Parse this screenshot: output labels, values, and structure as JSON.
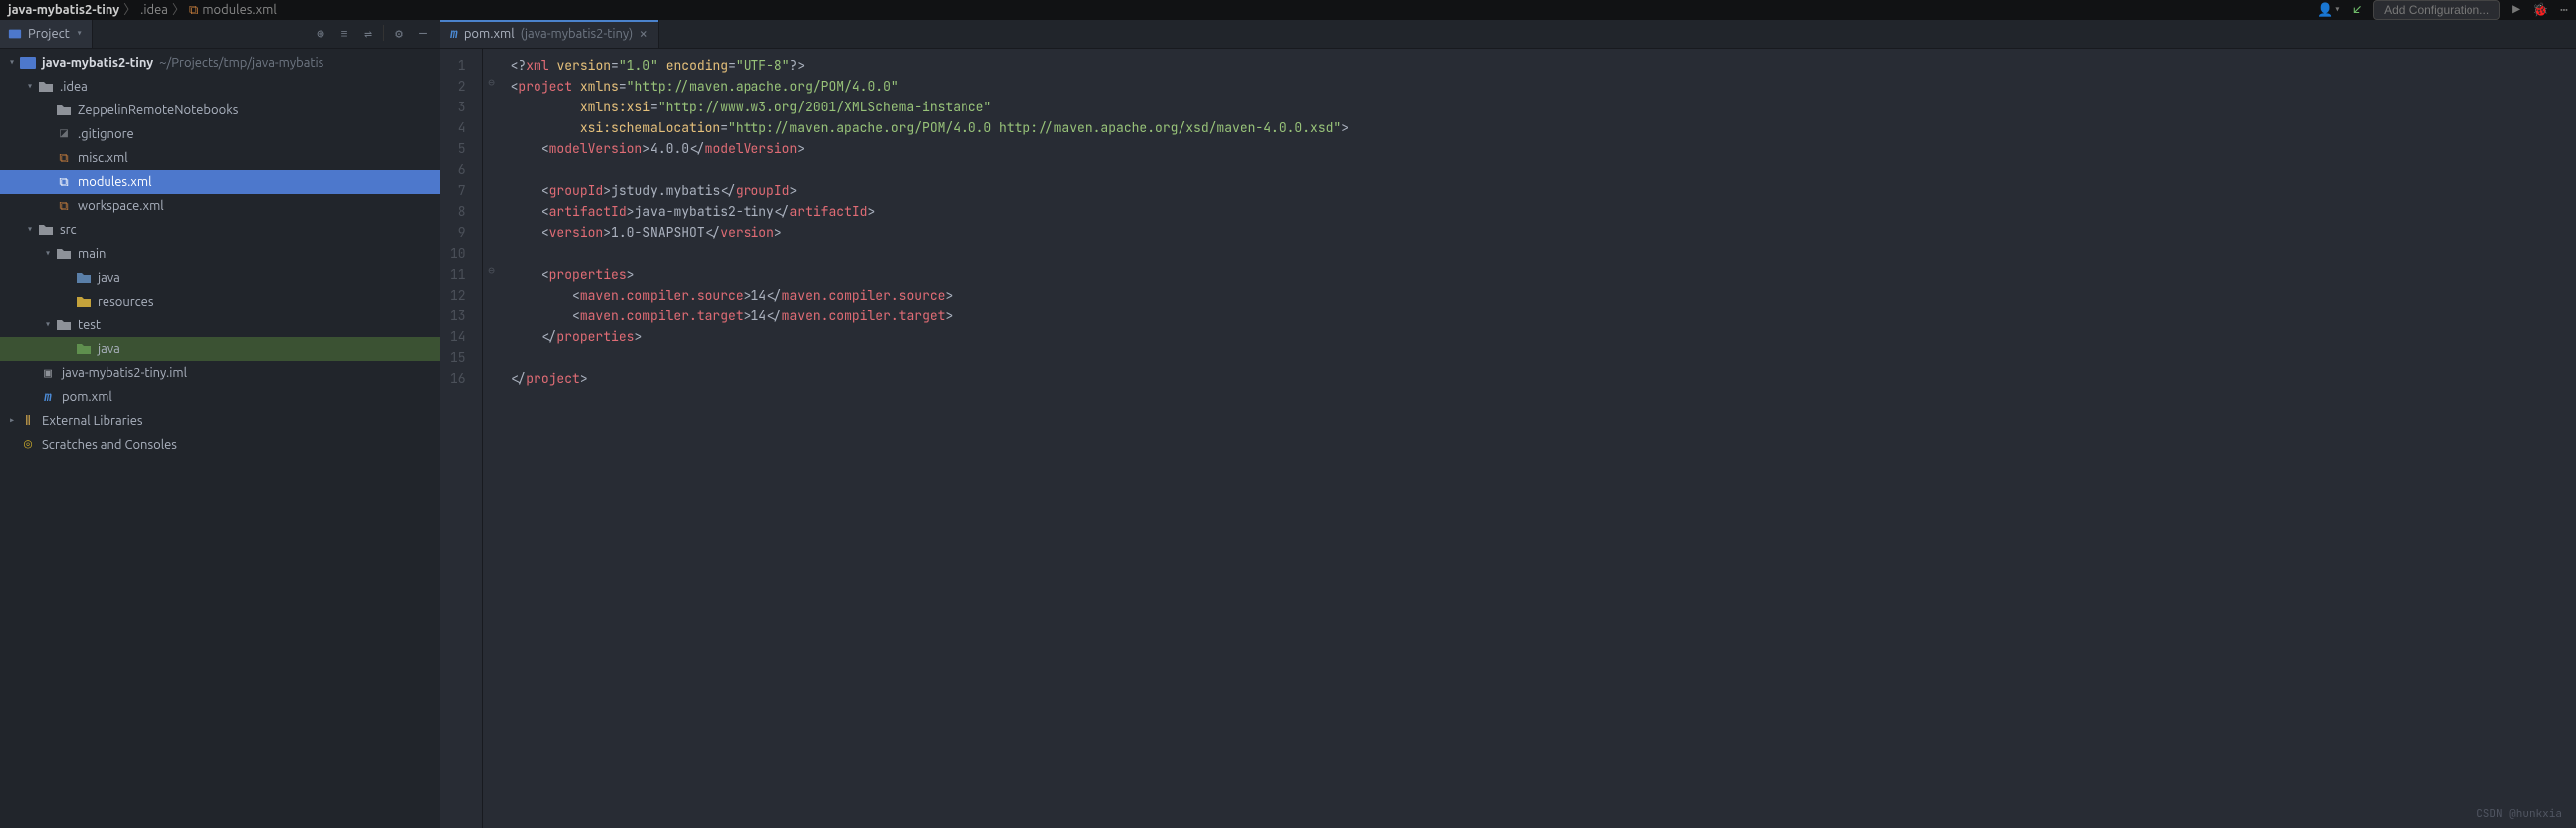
{
  "breadcrumb": {
    "root": "java-mybatis2-tiny",
    "p1": ".idea",
    "p2": "modules.xml"
  },
  "run_config": "Add Configuration...",
  "project_label": "Project",
  "tree": {
    "root": {
      "name": "java-mybatis2-tiny",
      "path": "~/Projects/tmp/java-mybatis"
    },
    "idea": ".idea",
    "zeppelin": "ZeppelinRemoteNotebooks",
    "gitignore": ".gitignore",
    "misc": "misc.xml",
    "modules": "modules.xml",
    "workspace": "workspace.xml",
    "src": "src",
    "main": "main",
    "main_java": "java",
    "main_res": "resources",
    "test": "test",
    "test_java": "java",
    "iml": "java-mybatis2-tiny.iml",
    "pom": "pom.xml",
    "ext": "External Libraries",
    "scratch": "Scratches and Consoles"
  },
  "tab": {
    "file": "pom.xml",
    "qual": "(java-mybatis2-tiny)"
  },
  "gutter": [
    "1",
    "2",
    "3",
    "4",
    "5",
    "6",
    "7",
    "8",
    "9",
    "10",
    "11",
    "12",
    "13",
    "14",
    "15",
    "16"
  ],
  "fold": [
    "",
    "⊖",
    "",
    "",
    "",
    "",
    "",
    "",
    "",
    "",
    "⊖",
    "",
    "",
    "",
    "",
    ""
  ],
  "watermark": "CSDN @hunkxia",
  "chart_data": {
    "type": "table",
    "title": "pom.xml",
    "xml": {
      "declaration": {
        "version": "1.0",
        "encoding": "UTF-8"
      },
      "project": {
        "xmlns": "http://maven.apache.org/POM/4.0.0",
        "xmlns:xsi": "http://www.w3.org/2001/XMLSchema-instance",
        "xsi:schemaLocation": "http://maven.apache.org/POM/4.0.0 http://maven.apache.org/xsd/maven-4.0.0.xsd",
        "modelVersion": "4.0.0",
        "groupId": "jstudy.mybatis",
        "artifactId": "java-mybatis2-tiny",
        "version": "1.0-SNAPSHOT",
        "properties": {
          "maven.compiler.source": "14",
          "maven.compiler.target": "14"
        }
      }
    }
  }
}
